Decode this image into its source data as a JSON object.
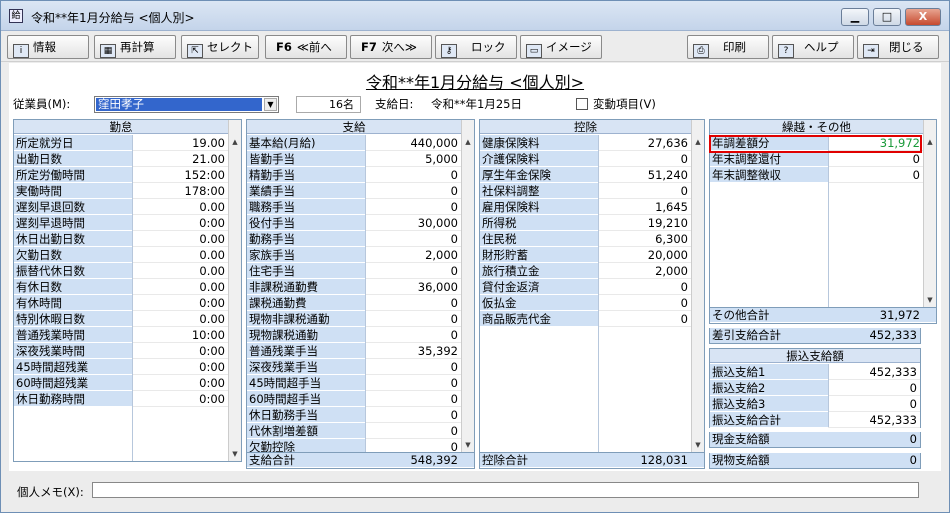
{
  "window": {
    "title": "令和**年1月分給与 <個人別>",
    "min": "▁",
    "max": "□",
    "close": "X"
  },
  "toolbar": [
    {
      "key": "",
      "label": "情報",
      "icon": "info-icon"
    },
    {
      "key": "",
      "label": "再計算",
      "icon": "calculator-icon"
    },
    {
      "key": "",
      "label": "セレクト",
      "icon": "select-icon"
    },
    {
      "key": "F6",
      "label": "≪前へ",
      "icon": ""
    },
    {
      "key": "F7",
      "label": "次へ≫",
      "icon": ""
    },
    {
      "key": "",
      "label": "ロック",
      "icon": "key-lock-icon"
    },
    {
      "key": "",
      "label": "イメージ",
      "icon": "monitor-icon"
    },
    {
      "key": "",
      "label": "印刷",
      "icon": "printer-icon"
    },
    {
      "key": "",
      "label": "ヘルプ",
      "icon": "help-icon"
    },
    {
      "key": "",
      "label": "閉じる",
      "icon": "exit-icon"
    }
  ],
  "page_title": "令和**年1月分給与 <個人別>",
  "header": {
    "employee_label": "従業員(M):",
    "employee_value": "窪田孝子",
    "count": "16名",
    "payday_label": "支給日:",
    "payday_value": "令和**年1月25日",
    "variable_label": "変動項目(V)"
  },
  "attendance": {
    "title": "勤怠",
    "rows": [
      [
        "所定就労日",
        "19.00"
      ],
      [
        "出勤日数",
        "21.00"
      ],
      [
        "所定労働時間",
        "152:00"
      ],
      [
        "実働時間",
        "178:00"
      ],
      [
        "遅刻早退回数",
        "0.00"
      ],
      [
        "遅刻早退時間",
        "0:00"
      ],
      [
        "休日出勤日数",
        "0.00"
      ],
      [
        "欠勤日数",
        "0.00"
      ],
      [
        "振替代休日数",
        "0.00"
      ],
      [
        "有休日数",
        "0.00"
      ],
      [
        "有休時間",
        "0:00"
      ],
      [
        "特別休暇日数",
        "0.00"
      ],
      [
        "普通残業時間",
        "10:00"
      ],
      [
        "深夜残業時間",
        "0:00"
      ],
      [
        "45時間超残業",
        "0:00"
      ],
      [
        "60時間超残業",
        "0:00"
      ],
      [
        "休日勤務時間",
        "0:00"
      ]
    ]
  },
  "payments": {
    "title": "支給",
    "rows": [
      [
        "基本給(月給)",
        "440,000"
      ],
      [
        "皆勤手当",
        "5,000"
      ],
      [
        "精勤手当",
        "0"
      ],
      [
        "業績手当",
        "0"
      ],
      [
        "職務手当",
        "0"
      ],
      [
        "役付手当",
        "30,000"
      ],
      [
        "勤務手当",
        "0"
      ],
      [
        "家族手当",
        "2,000"
      ],
      [
        "住宅手当",
        "0"
      ],
      [
        "非課税通勤費",
        "36,000"
      ],
      [
        "課税通勤費",
        "0"
      ],
      [
        "現物非課税通勤",
        "0"
      ],
      [
        "現物課税通勤",
        "0"
      ],
      [
        "普通残業手当",
        "35,392"
      ],
      [
        "深夜残業手当",
        "0"
      ],
      [
        "45時間超手当",
        "0"
      ],
      [
        "60時間超手当",
        "0"
      ],
      [
        "休日勤務手当",
        "0"
      ],
      [
        "代休割増差額",
        "0"
      ],
      [
        "欠勤控除",
        "0"
      ]
    ],
    "total_label": "支給合計",
    "total_value": "548,392"
  },
  "deductions": {
    "title": "控除",
    "rows": [
      [
        "健康保険料",
        "27,636"
      ],
      [
        "介護保険料",
        "0"
      ],
      [
        "厚生年金保険",
        "51,240"
      ],
      [
        "社保料調整",
        "0"
      ],
      [
        "雇用保険料",
        "1,645"
      ],
      [
        "所得税",
        "19,210"
      ],
      [
        "住民税",
        "6,300"
      ],
      [
        "財形貯蓄",
        "20,000"
      ],
      [
        "旅行積立金",
        "2,000"
      ],
      [
        "貸付金返済",
        "0"
      ],
      [
        "仮払金",
        "0"
      ],
      [
        "商品販売代金",
        "0"
      ]
    ],
    "total_label": "控除合計",
    "total_value": "128,031"
  },
  "carryover": {
    "title": "繰越・その他",
    "rows": [
      [
        "年調差額分",
        "31,972"
      ],
      [
        "年末調整還付",
        "0"
      ],
      [
        "年末調整徴収",
        "0"
      ]
    ],
    "total_label": "その他合計",
    "total_value": "31,972"
  },
  "net": {
    "label": "差引支給合計",
    "value": "452,333"
  },
  "transfer": {
    "title": "振込支給額",
    "rows": [
      [
        "振込支給1",
        "452,333"
      ],
      [
        "振込支給2",
        "0"
      ],
      [
        "振込支給3",
        "0"
      ],
      [
        "振込支給合計",
        "452,333"
      ]
    ]
  },
  "cash": {
    "label": "現金支給額",
    "value": "0"
  },
  "inkind": {
    "label": "現物支給額",
    "value": "0"
  },
  "memo": {
    "label": "個人メモ(X):",
    "value": ""
  },
  "colors": {
    "highlight": "#e00000",
    "green_value": "#1a9a3a",
    "row_label_bg": "#cfe0f4",
    "selection": "#3366cc"
  }
}
